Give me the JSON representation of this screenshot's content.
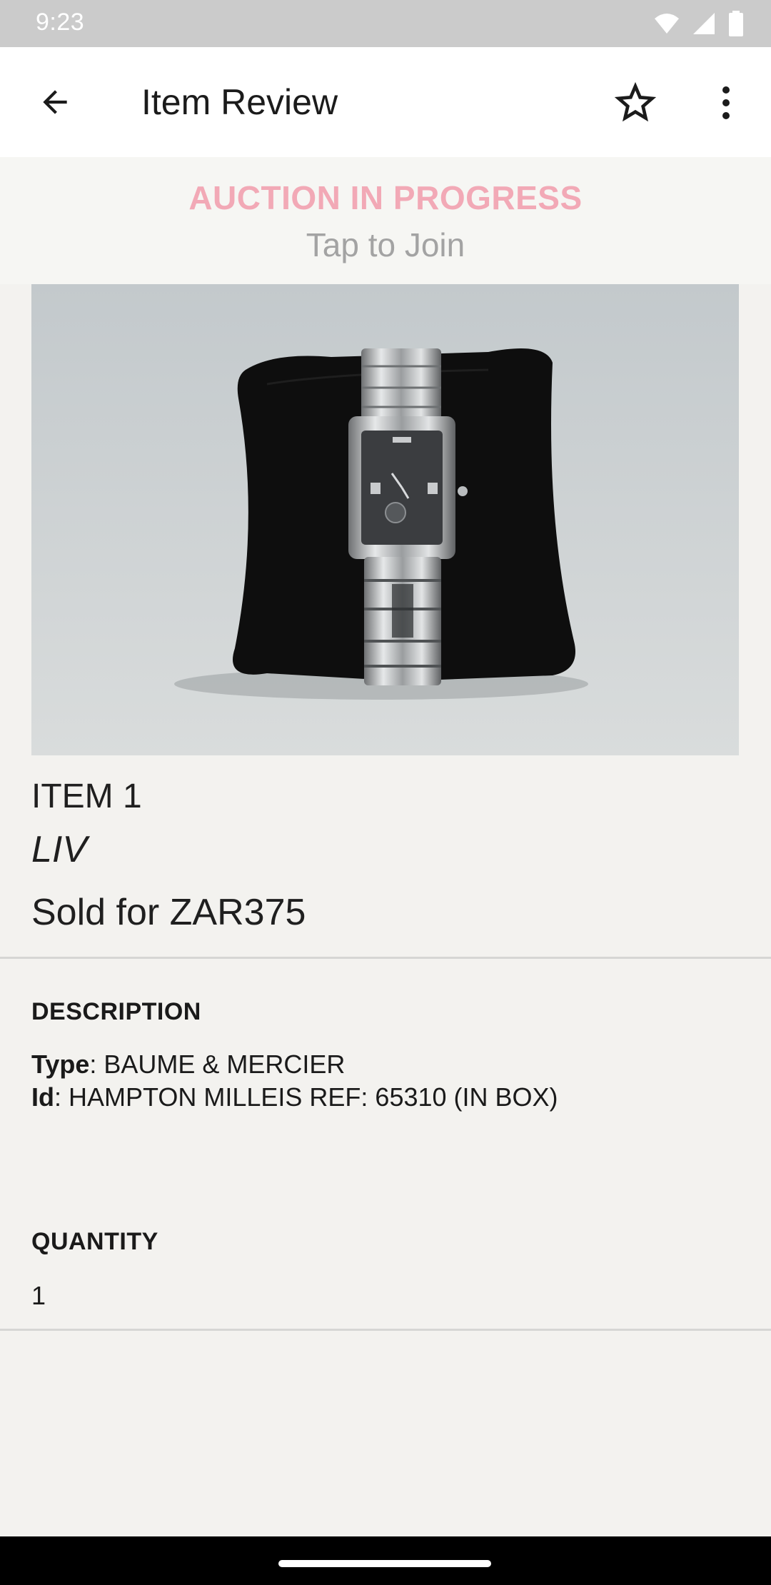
{
  "status_bar": {
    "time": "9:23"
  },
  "app_bar": {
    "title": "Item Review"
  },
  "banner": {
    "status": "AUCTION IN PROGRESS",
    "cta": "Tap to Join"
  },
  "item": {
    "number": "ITEM 1",
    "name": "LIV",
    "sold_text": "Sold for ZAR375"
  },
  "description": {
    "heading": "DESCRIPTION",
    "fields": [
      {
        "label": "Type",
        "value": ": BAUME & MERCIER"
      },
      {
        "label": "Id",
        "value": ": HAMPTON MILLEIS REF: 65310 (IN BOX)"
      }
    ]
  },
  "quantity": {
    "heading": "QUANTITY",
    "value": "1"
  },
  "icons": {
    "back": "arrow-back-icon",
    "favorite": "star-outline-icon",
    "more": "more-vert-icon",
    "wifi": "wifi-icon",
    "signal": "signal-icon",
    "battery": "battery-icon"
  },
  "colors": {
    "auction_status": "#f2a9b6",
    "cta": "#a3a3a3",
    "app_bar": "#ffffff",
    "background": "#f3f2ef"
  }
}
